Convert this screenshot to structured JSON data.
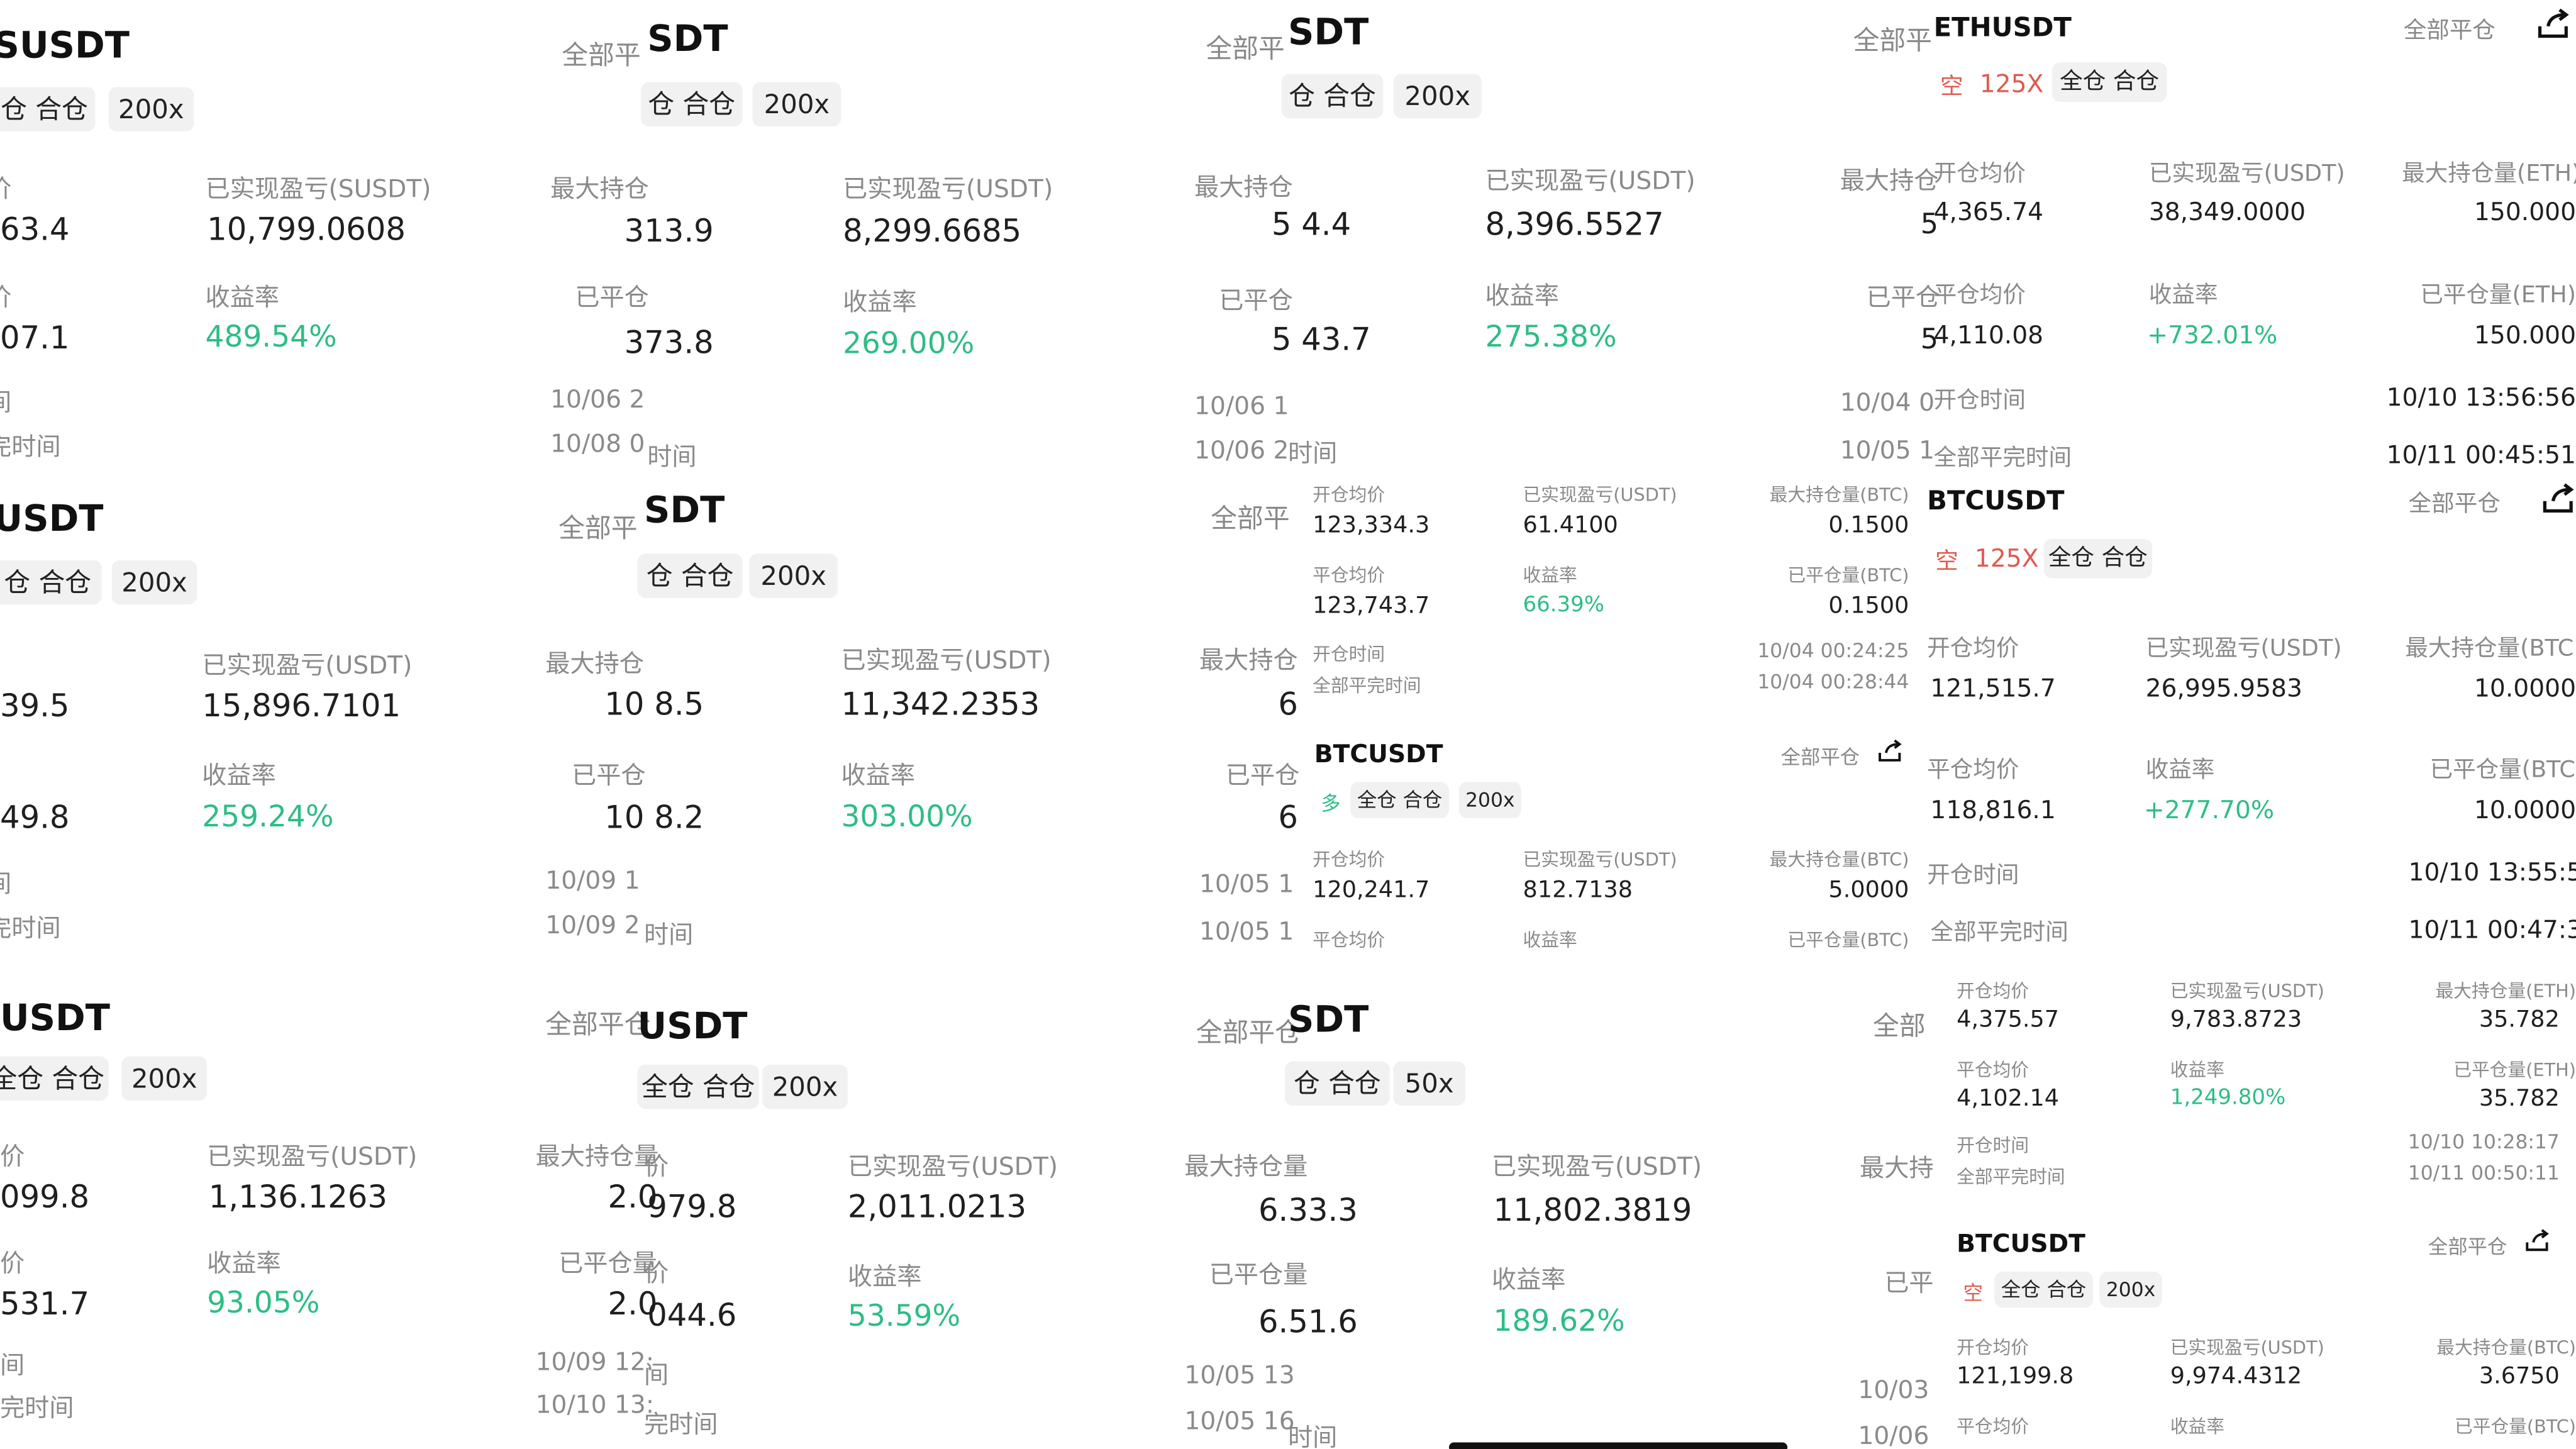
{
  "panels": {
    "r1a": {
      "symbol": "SUSDT",
      "mode": "仓 合仓",
      "leverage": "200x",
      "pnl_label": "已实现盈亏(SUSDT)",
      "pnl": "10,799.0608",
      "roi_label": "收益率",
      "roi": "489.54%",
      "open_price": "63.4",
      "close_price": "07.1",
      "open_label": "价",
      "close_label": "价",
      "time_label_1": "间",
      "time_label_2": "完时间"
    },
    "r1b": {
      "close_all": "全部平",
      "symbol": "SDT",
      "mode": "仓 合仓",
      "leverage": "200x",
      "max_pos_label": "最大持仓",
      "max_pos": "313.9",
      "closed_label": "已平仓",
      "closed": "373.8",
      "open_time": "10/06 2",
      "close_time": "10/08 0",
      "pnl_label": "已实现盈亏(USDT)",
      "pnl": "8,299.6685",
      "roi_label": "收益率",
      "roi": "269.00%",
      "time_label": "时间"
    },
    "r1c": {
      "close_all": "全部平",
      "symbol": "SDT",
      "mode": "仓 合仓",
      "leverage": "200x",
      "max_pos_label": "最大持仓",
      "max_pos": "5 4.4",
      "closed_label": "已平仓",
      "closed": "5 43.7",
      "open_time": "10/06 1",
      "close_time": "10/06 2",
      "pnl_label": "已实现盈亏(USDT)",
      "pnl": "8,396.5527",
      "roi_label": "收益率",
      "roi": "275.38%",
      "time_label": "时间"
    },
    "r1d": {
      "close_all_left": "全部平",
      "symbol": "ETHUSDT",
      "close_all": "全部平仓",
      "side": "空",
      "leverage": "125X",
      "mode": "全仓 合仓",
      "cut_label_1": "最大持仓",
      "cut_val_1": "5",
      "cut_label_2": "已平仓",
      "cut_val_2": "5",
      "cut_time_1": "10/04 0",
      "cut_time_2": "10/05 1",
      "open_avg_label": "开仓均价",
      "open_avg": "4,365.74",
      "pnl_label": "已实现盈亏(USDT)",
      "pnl": "38,349.0000",
      "max_pos_label": "最大持仓量(ETH)",
      "max_pos": "150.000",
      "close_avg_label": "平仓均价",
      "close_avg": "4,110.08",
      "roi_label": "收益率",
      "roi": "+732.01%",
      "closed_label": "已平仓量(ETH)",
      "closed": "150.000",
      "open_time_label": "开仓时间",
      "open_time": "10/10 13:56:56",
      "close_time_label": "全部平完时间",
      "close_time": "10/11 00:45:51"
    },
    "r2a": {
      "symbol": "USDT",
      "mode": "仓 合仓",
      "leverage": "200x",
      "pnl_label": "已实现盈亏(USDT)",
      "pnl": "15,896.7101",
      "roi_label": "收益率",
      "roi": "259.24%",
      "open_price": "39.5",
      "close_price": "49.8",
      "time_label_1": "间",
      "time_label_2": "完时间"
    },
    "r2b": {
      "close_all": "全部平",
      "symbol": "SDT",
      "mode": "仓 合仓",
      "leverage": "200x",
      "max_pos_label": "最大持仓",
      "max_pos": "10 8.5",
      "closed_label": "已平仓",
      "closed": "10 8.2",
      "open_time": "10/09 1",
      "close_time": "10/09 2",
      "pnl_label": "已实现盈亏(USDT)",
      "pnl": "11,342.2353",
      "roi_label": "收益率",
      "roi": "303.00%",
      "time_label": "时间"
    },
    "r2c_left": {
      "close_all": "全部平",
      "max_pos_label": "最大持仓",
      "max_pos": "6",
      "closed_label": "已平仓",
      "closed": "6",
      "open_time": "10/05 1",
      "close_time": "10/05 1"
    },
    "r2c_top": {
      "open_avg_label": "开仓均价",
      "open_avg": "123,334.3",
      "pnl_label": "已实现盈亏(USDT)",
      "pnl": "61.4100",
      "max_pos_label": "最大持仓量(BTC)",
      "max_pos": "0.1500",
      "close_avg_label": "平仓均价",
      "close_avg": "123,743.7",
      "roi_label": "收益率",
      "roi": "66.39%",
      "closed_label": "已平仓量(BTC)",
      "closed": "0.1500",
      "open_time_label": "开仓时间",
      "open_time": "10/04 00:24:25",
      "close_time_label": "全部平完时间",
      "close_time": "10/04 00:28:44"
    },
    "r2c_bottom": {
      "symbol": "BTCUSDT",
      "close_all": "全部平仓",
      "side": "多",
      "mode": "全仓 合仓",
      "leverage": "200x",
      "open_avg_label": "开仓均价",
      "open_avg": "120,241.7",
      "pnl_label": "已实现盈亏(USDT)",
      "pnl": "812.7138",
      "max_pos_label": "最大持仓量(BTC)",
      "max_pos": "5.0000",
      "close_avg_label": "平仓均价",
      "roi_label": "收益率",
      "closed_label": "已平仓量(BTC)"
    },
    "r2d": {
      "symbol": "BTCUSDT",
      "close_all": "全部平仓",
      "side": "空",
      "leverage": "125X",
      "mode": "全仓 合仓",
      "open_avg_label": "开仓均价",
      "open_avg": "121,515.7",
      "pnl_label": "已实现盈亏(USDT)",
      "pnl": "26,995.9583",
      "max_pos_label": "最大持仓量(BTC",
      "max_pos": "10.0000",
      "close_avg_label": "平仓均价",
      "close_avg": "118,816.1",
      "roi_label": "收益率",
      "roi": "+277.70%",
      "closed_label": "已平仓量(BTC",
      "closed": "10.0000",
      "open_time_label": "开仓时间",
      "open_time": "10/10 13:55:59",
      "close_time_label": "全部平完时间",
      "close_time": "10/11 00:47:37"
    },
    "r3a": {
      "symbol": "USDT",
      "mode": "全仓 合仓",
      "leverage": "200x",
      "pnl_label": "已实现盈亏(USDT)",
      "pnl": "1,136.1263",
      "roi_label": "收益率",
      "roi": "93.05%",
      "open_price": "099.8",
      "close_price": "531.7",
      "open_label": "价",
      "close_label": "价",
      "time_label_1": "间",
      "time_label_2": "完时间"
    },
    "r3b": {
      "close_all": "全部平仓",
      "symbol": "USDT",
      "mode": "全仓 合仓",
      "leverage": "200x",
      "max_pos_label": "最大持仓量",
      "max_pos": "2.0",
      "closed_label": "已平仓量",
      "closed": "2.0",
      "open_time": "10/09 12:",
      "close_time": "10/10 13:",
      "open_price_label": "价",
      "open_price": "979.8",
      "close_price_label": "价",
      "close_price": "044.6",
      "time_label_1": "间",
      "time_label_2": "完时间",
      "pnl_label": "已实现盈亏(USDT)",
      "pnl": "2,011.0213",
      "roi_label": "收益率",
      "roi": "53.59%"
    },
    "r3c": {
      "close_all": "全部平仓",
      "symbol": "SDT",
      "mode": "仓 合仓",
      "leverage": "50x",
      "max_pos_label": "最大持仓量",
      "max_pos": "6.33.3",
      "closed_label": "已平仓量",
      "closed": "6.51.6",
      "open_time": "10/05 13",
      "close_time": "10/05 16",
      "time_label": "时间",
      "pnl_label": "已实现盈亏(USDT)",
      "pnl": "11,802.3819",
      "roi_label": "收益率",
      "roi": "189.62%"
    },
    "r3d_left": {
      "close_all": "全部",
      "max_pos_label": "最大持",
      "closed_label": "已平",
      "open_time": "10/03",
      "close_time": "10/06"
    },
    "r3d_top": {
      "open_avg_label": "开仓均价",
      "open_avg": "4,375.57",
      "pnl_label": "已实现盈亏(USDT)",
      "pnl": "9,783.8723",
      "max_pos_label": "最大持仓量(ETH)",
      "max_pos": "35.782",
      "close_avg_label": "平仓均价",
      "close_avg": "4,102.14",
      "roi_label": "收益率",
      "roi": "1,249.80%",
      "closed_label": "已平仓量(ETH)",
      "closed": "35.782",
      "open_time_label": "开仓时间",
      "open_time": "10/10 10:28:17",
      "close_time_label": "全部平完时间",
      "close_time": "10/11 00:50:11"
    },
    "r3d_bottom": {
      "symbol": "BTCUSDT",
      "close_all": "全部平仓",
      "side": "空",
      "mode": "全仓 合仓",
      "leverage": "200x",
      "open_avg_label": "开仓均价",
      "open_avg": "121,199.8",
      "pnl_label": "已实现盈亏(USDT)",
      "pnl": "9,974.4312",
      "max_pos_label": "最大持仓量(BTC)",
      "max_pos": "3.6750",
      "close_avg_label": "平仓均价",
      "roi_label": "收益率",
      "closed_label": "已平仓量(BTC)"
    }
  },
  "colors": {
    "profit": "#2ebd85",
    "short": "#e05a4e",
    "label": "#8a8a8a",
    "tag_bg": "#f1f1f1"
  },
  "icons": {
    "share": "share-icon"
  }
}
